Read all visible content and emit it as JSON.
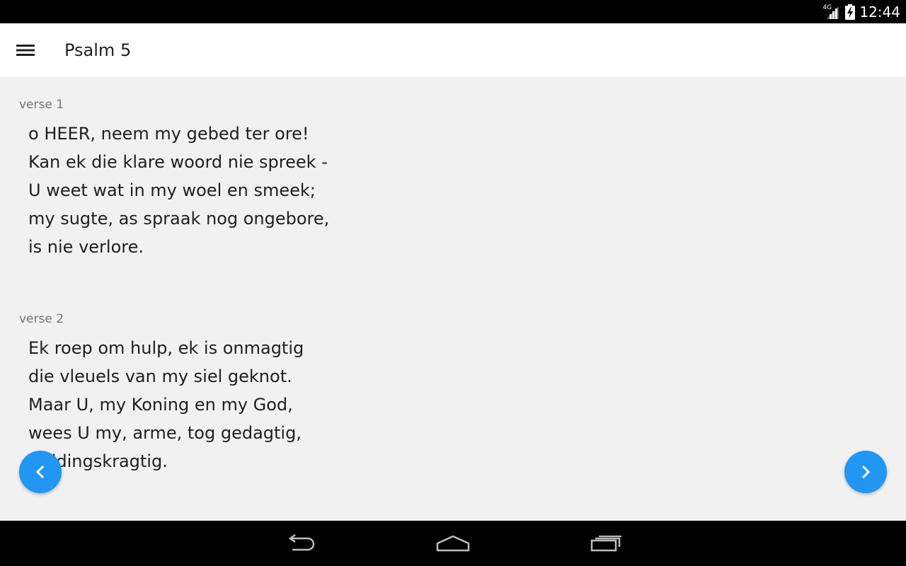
{
  "status_bar": {
    "network": "4G",
    "time": "12:44"
  },
  "app_bar": {
    "menu_icon": "hamburger-menu-icon",
    "title": "Psalm 5"
  },
  "verses": [
    {
      "label": "verse 1",
      "lines": [
        "o HEER, neem my gebed ter ore!",
        "Kan ek die klare woord nie spreek -",
        "U weet wat in my woel en smeek;",
        "my sugte, as spraak nog ongebore,",
        "is nie verlore."
      ]
    },
    {
      "label": "verse 2",
      "lines": [
        "Ek roep om hulp, ek is onmagtig",
        "die vleuels van my siel geknot.",
        "Maar U, my Koning en my God,",
        "wees U my, arme, tog gedagtig,",
        "reddingskragtig."
      ]
    }
  ],
  "navigation": {
    "prev_icon": "chevron-left-icon",
    "next_icon": "chevron-right-icon",
    "accent_color": "#2196f3"
  },
  "system_nav": {
    "back_icon": "back-icon",
    "home_icon": "home-icon",
    "recents_icon": "recents-icon"
  }
}
